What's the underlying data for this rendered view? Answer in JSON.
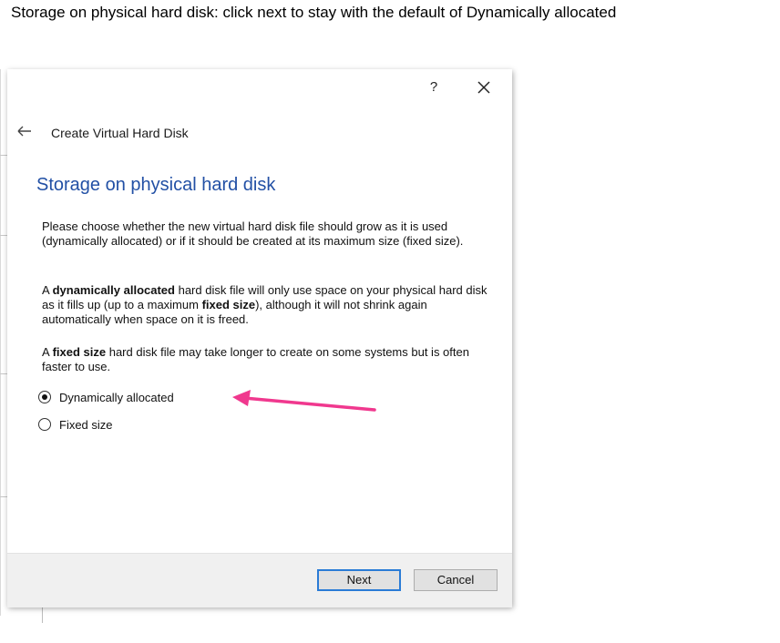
{
  "caption": "Storage on physical hard disk:  click next to stay with the default of Dynamically allocated",
  "dialog": {
    "help_label": "?",
    "wizard_title": "Create Virtual Hard Disk",
    "heading": "Storage on physical hard disk",
    "para1": "Please choose whether the new virtual hard disk file should grow as it is used (dynamically allocated) or if it should be created at its maximum size (fixed size).",
    "para2": {
      "a": "A ",
      "b": "dynamically allocated",
      "c": " hard disk file will only use space on your physical hard disk as it fills up (up to a maximum ",
      "d": "fixed size",
      "e": "), although it will not shrink again automatically when space on it is freed."
    },
    "para3": {
      "a": "A ",
      "b": "fixed size",
      "c": " hard disk file may take longer to create on some systems but is often faster to use."
    },
    "options": [
      {
        "label": "Dynamically allocated",
        "selected": true
      },
      {
        "label": "Fixed size",
        "selected": false
      }
    ],
    "buttons": {
      "next": "Next",
      "cancel": "Cancel"
    }
  },
  "colors": {
    "heading": "#2250a5",
    "annotation_arrow": "#f0388e",
    "default_button_border": "#2a7bd6"
  },
  "icons": {
    "close": "close-icon",
    "back": "arrow-left-icon"
  }
}
